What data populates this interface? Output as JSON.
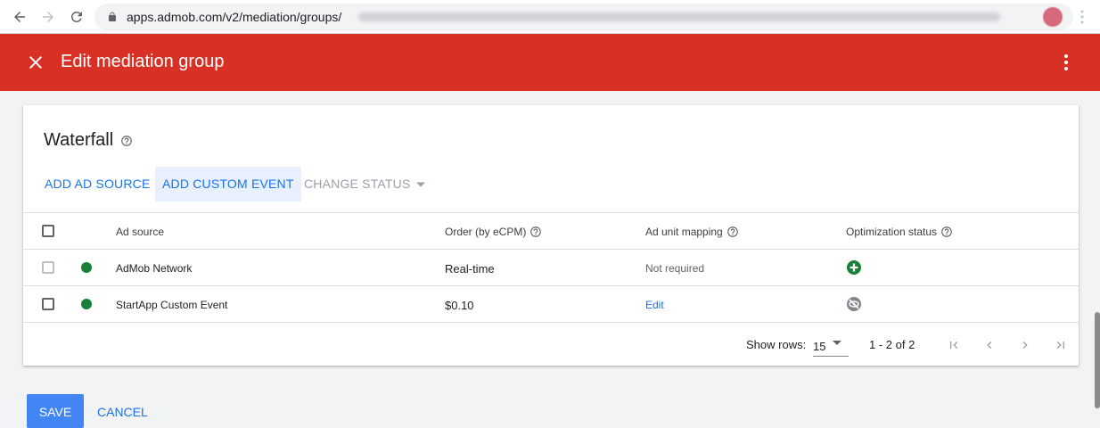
{
  "browser": {
    "url": "apps.admob.com/v2/mediation/groups/",
    "url_redacted": "blurred",
    "profile": "avatar"
  },
  "header": {
    "title": "Edit mediation group",
    "background": "#d93025"
  },
  "waterfall": {
    "title": "Waterfall",
    "actions": {
      "add_ad_source": "ADD AD SOURCE",
      "add_custom_event": "ADD CUSTOM EVENT",
      "change_status": "CHANGE STATUS"
    },
    "columns": {
      "ad_source": "Ad source",
      "order": "Order (by eCPM)",
      "mapping": "Ad unit mapping",
      "optimization": "Optimization status"
    },
    "rows": [
      {
        "ad_source": "AdMob Network",
        "order": "Real-time",
        "mapping": "Not required",
        "status_color": "#188038",
        "optimization_icon": "plus-circle-icon",
        "checkbox_enabled": false
      },
      {
        "ad_source": "StartApp Custom Event",
        "order": "$0.10",
        "mapping": "Edit",
        "status_color": "#188038",
        "optimization_icon": "visibility-off-icon",
        "checkbox_enabled": true
      }
    ],
    "footer": {
      "show_rows_label": "Show rows:",
      "rows_per_page": "15",
      "range": "1 - 2 of 2"
    }
  },
  "form_actions": {
    "save": "SAVE",
    "cancel": "CANCEL"
  },
  "colors": {
    "primary": "#1a73e8",
    "save_button": "#4285f4",
    "status_green": "#188038"
  }
}
